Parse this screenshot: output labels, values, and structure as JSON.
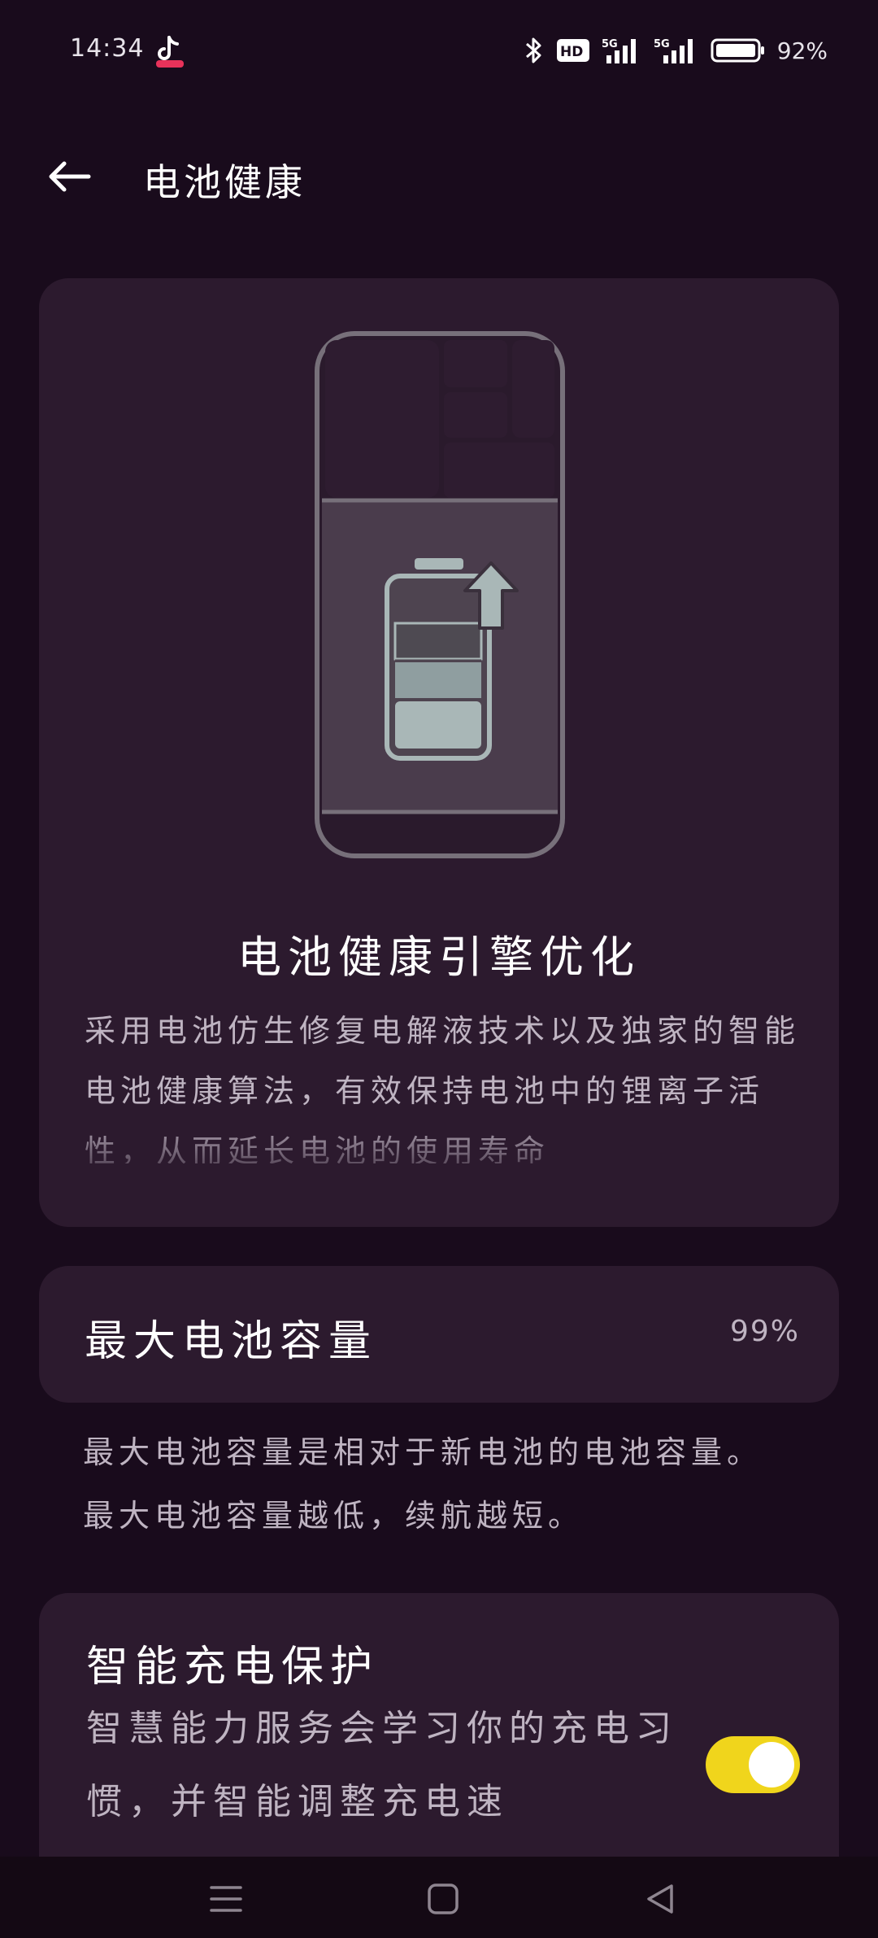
{
  "status_bar": {
    "time": "14:34",
    "battery_percent": "92%",
    "icons": [
      "tiktok-icon",
      "bluetooth-icon",
      "hd-icon",
      "signal-5g-icon",
      "signal-5g-icon",
      "battery-icon"
    ]
  },
  "app_bar": {
    "title": "电池健康",
    "back_icon": "arrow-left-icon"
  },
  "hero": {
    "title": "电池健康引擎优化",
    "description": "采用电池仿生修复电解液技术以及独家的智能电池健康算法，有效保持电池中的锂离子活性，从而延长电池的使用寿命"
  },
  "capacity": {
    "label": "最大电池容量",
    "value": "99%",
    "description": "最大电池容量是相对于新电池的电池容量。最大电池容量越低，续航越短。"
  },
  "smart_charge": {
    "title": "智能充电保护",
    "description": "智慧能力服务会学习你的充电习惯，并智能调整充电速",
    "toggle_on": true
  },
  "colors": {
    "background": "#190b1c",
    "card": "#2c1a2e",
    "toggle_accent": "#f0d51c"
  },
  "nav_bar": {
    "icons": [
      "menu-icon",
      "home-square-icon",
      "back-triangle-icon"
    ]
  }
}
